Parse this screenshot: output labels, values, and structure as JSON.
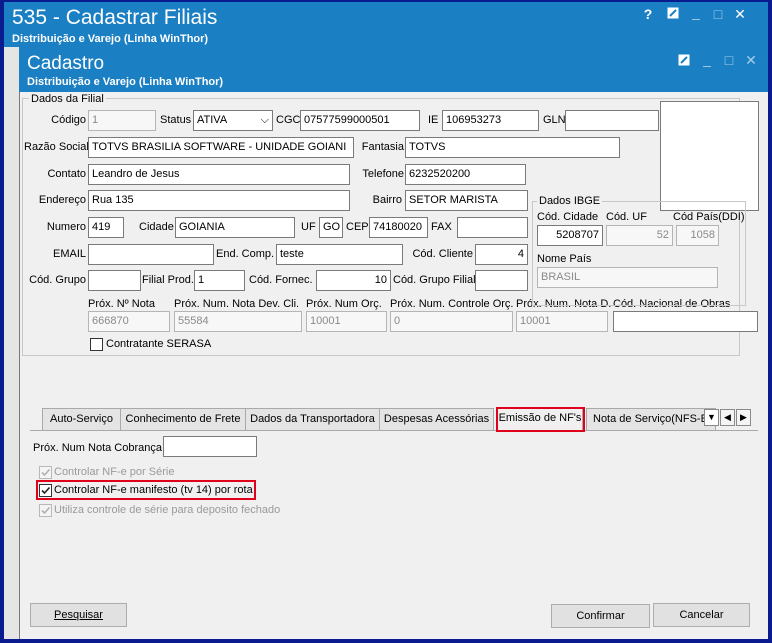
{
  "outer_window": {
    "title": "535 - Cadastrar Filiais",
    "subtitle": "Distribuição e Varejo (Linha WinThor)"
  },
  "inner_window": {
    "title": "Cadastro",
    "subtitle": "Distribuição e Varejo (Linha WinThor)"
  },
  "dados_filial": {
    "group_label": "Dados da Filial",
    "codigo": {
      "label": "Código",
      "value": "1"
    },
    "status": {
      "label": "Status",
      "value": "ATIVA"
    },
    "cgc": {
      "label": "CGC",
      "value": "07577599000501"
    },
    "ie": {
      "label": "IE",
      "value": "106953273"
    },
    "gln": {
      "label": "GLN",
      "value": ""
    },
    "razao_social": {
      "label": "Razão Social",
      "value": "TOTVS BRASILIA SOFTWARE - UNIDADE GOIANI"
    },
    "fantasia": {
      "label": "Fantasia",
      "value": "TOTVS"
    },
    "contato": {
      "label": "Contato",
      "value": "Leandro de Jesus"
    },
    "telefone": {
      "label": "Telefone",
      "value": "6232520200"
    },
    "endereco": {
      "label": "Endereço",
      "value": "Rua 135"
    },
    "bairro": {
      "label": "Bairro",
      "value": "SETOR MARISTA"
    },
    "numero": {
      "label": "Numero",
      "value": "419"
    },
    "cidade": {
      "label": "Cidade",
      "value": "GOIANIA"
    },
    "uf": {
      "label": "UF",
      "value": "GO"
    },
    "cep": {
      "label": "CEP",
      "value": "74180020"
    },
    "fax": {
      "label": "FAX",
      "value": ""
    },
    "email": {
      "label": "EMAIL",
      "value": ""
    },
    "end_comp": {
      "label": "End. Comp.",
      "value": "teste"
    },
    "cod_cliente": {
      "label": "Cód. Cliente",
      "value": "4"
    },
    "cod_grupo": {
      "label": "Cód. Grupo",
      "value": ""
    },
    "filial_prod": {
      "label": "Filial Prod.",
      "value": "1"
    },
    "cod_fornec": {
      "label": "Cód. Fornec.",
      "value": "10"
    },
    "cod_grupo_filial": {
      "label": "Cód. Grupo Filial",
      "value": ""
    },
    "prox_nota": {
      "label": "Próx. Nº Nota",
      "value": "666870"
    },
    "prox_nota_dev": {
      "label": "Próx. Num. Nota Dev. Cli.",
      "value": "55584"
    },
    "prox_orc": {
      "label": "Próx. Num Orç.",
      "value": "10001"
    },
    "prox_ctrl_orc": {
      "label": "Próx. Num. Controle Orç.",
      "value": "0"
    },
    "prox_nota_d": {
      "label": "Próx. Num. Nota D.",
      "value": "10001"
    },
    "cod_obras": {
      "label": "Cód. Nacional de Obras",
      "value": ""
    },
    "contratante_serasa": "Contratante SERASA"
  },
  "dados_ibge": {
    "group_label": "Dados IBGE",
    "cod_cidade": {
      "label": "Cód. Cidade",
      "value": "5208707"
    },
    "cod_uf": {
      "label": "Cód. UF",
      "value": "52"
    },
    "cod_pais": {
      "label": "Cód País(DDI)",
      "value": "1058"
    },
    "nome_pais": {
      "label": "Nome País",
      "value": "BRASIL"
    }
  },
  "tabs": [
    "Auto-Serviço",
    "Conhecimento de Frete",
    "Dados da Transportadora",
    "Despesas Acessórias",
    "Emissão de NF's",
    "Nota de Serviço(NFS-E"
  ],
  "tab_nav": {
    "dropdown": "▼",
    "prev": "◀",
    "next": "▶"
  },
  "emissao_tab": {
    "prox_num_cobranca": {
      "label": "Próx. Num Nota Cobrança",
      "value": ""
    },
    "checks": {
      "controlar_serie": "Controlar NF-e por Série",
      "controlar_manifesto": "Controlar NF-e manifesto (tv 14) por rota",
      "utiliza_controle_serie": "Utiliza controle de série para deposito fechado"
    }
  },
  "buttons": {
    "pesquisar": "Pesquisar",
    "confirmar": "Confirmar",
    "cancelar": "Cancelar"
  },
  "window_controls": {
    "help": "?",
    "min": "_",
    "max": "□",
    "close": "✕"
  },
  "colors": {
    "title_blue": "#1b7fc4",
    "frame_navy": "#0a1b8f",
    "highlight_red": "#e0001b"
  }
}
